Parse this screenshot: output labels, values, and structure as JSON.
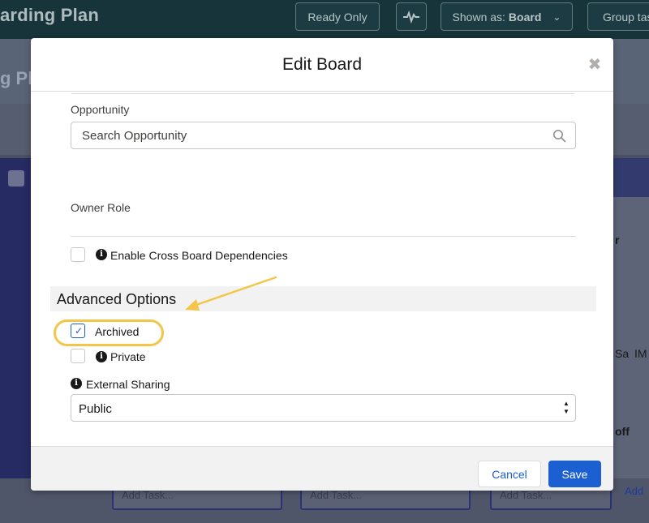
{
  "background": {
    "title": "arding Plan",
    "title_partial": "g Pla",
    "buttons": {
      "ready_only": "Ready Only",
      "activity_icon": "pulse-icon",
      "shown_as_prefix": "Shown as:",
      "shown_as_value": "Board",
      "group_tasks": "Group tas"
    },
    "right_texts": [
      "r",
      "Sa",
      "IM",
      "off"
    ],
    "footer": {
      "add_label": "Add",
      "add_task_placeholder": "Add Task..."
    }
  },
  "modal": {
    "title": "Edit Board",
    "close_icon": "close-icon",
    "fields": {
      "opportunity_label": "Opportunity",
      "opportunity_placeholder": "Search Opportunity",
      "owner_role_label": "Owner Role",
      "cross_board_label": "Enable Cross Board Dependencies"
    },
    "advanced": {
      "title": "Advanced Options",
      "archived_label": "Archived",
      "archived_checked": true,
      "private_label": "Private",
      "private_checked": false,
      "external_sharing_label": "External Sharing",
      "external_sharing_value": "Public"
    },
    "footer": {
      "cancel_label": "Cancel",
      "save_label": "Save"
    }
  },
  "annotations": {
    "highlight_color": "#f3c649"
  },
  "colors": {
    "brand": "#1b5fd1",
    "header_bg": "#17343b"
  }
}
